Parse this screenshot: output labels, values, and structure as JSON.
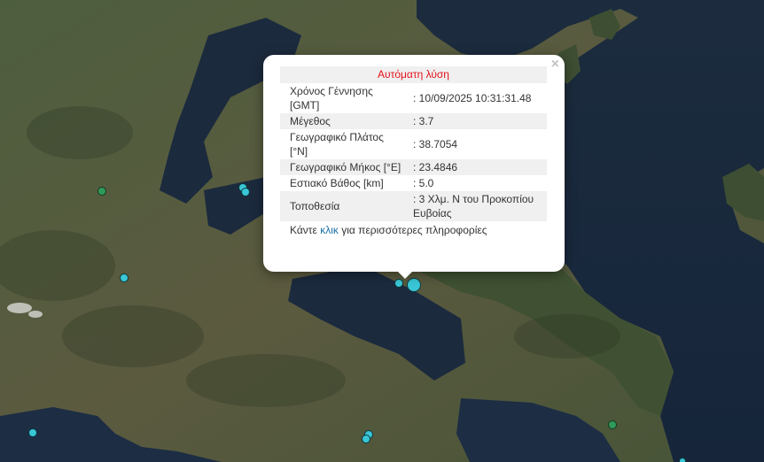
{
  "popup": {
    "title": "Αυτόματη λύση",
    "close_symbol": "×",
    "rows": [
      {
        "label": "Χρόνος Γέννησης [GMT]",
        "value": ": 10/09/2025 10:31:31.48"
      },
      {
        "label": "Μέγεθος",
        "value": ": 3.7"
      },
      {
        "label": "Γεωγραφικό Πλάτος [°N]",
        "value": ": 38.7054"
      },
      {
        "label": "Γεωγραφικό Μήκος [°E]",
        "value": ": 23.4846"
      },
      {
        "label": "Εστιακό Βάθος [km]",
        "value": ": 5.0"
      },
      {
        "label": "Τοποθεσία",
        "value": ": 3 Χλμ. Ν του Προκοπίου Ευβοίας"
      }
    ],
    "more_prefix": "Κάντε ",
    "more_link": "κλικ",
    "more_suffix": " για περισσότερες πληροφορίες"
  },
  "colors": {
    "title_red": "#e5121b",
    "link_blue": "#1d6fa5",
    "marker_cyan": "#39c6d6",
    "marker_green": "#2f9a5a",
    "sea": "#1a2a3a",
    "land": "#4a5a3c"
  }
}
